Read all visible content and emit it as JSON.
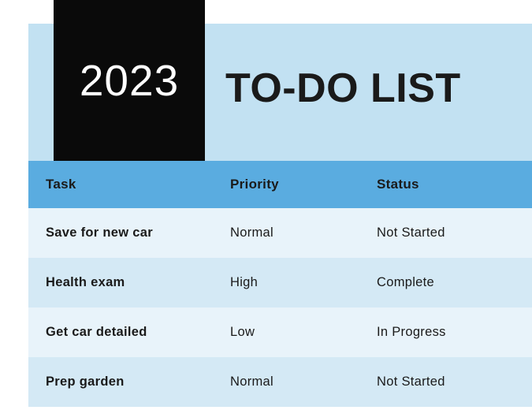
{
  "header": {
    "year": "2023",
    "title": "TO-DO LIST"
  },
  "columns": {
    "task": "Task",
    "priority": "Priority",
    "status": "Status"
  },
  "rows": [
    {
      "task": "Save for new car",
      "priority": "Normal",
      "status": "Not Started"
    },
    {
      "task": "Health exam",
      "priority": "High",
      "status": "Complete"
    },
    {
      "task": "Get car detailed",
      "priority": "Low",
      "status": "In Progress"
    },
    {
      "task": "Prep garden",
      "priority": "Normal",
      "status": "Not Started"
    }
  ]
}
